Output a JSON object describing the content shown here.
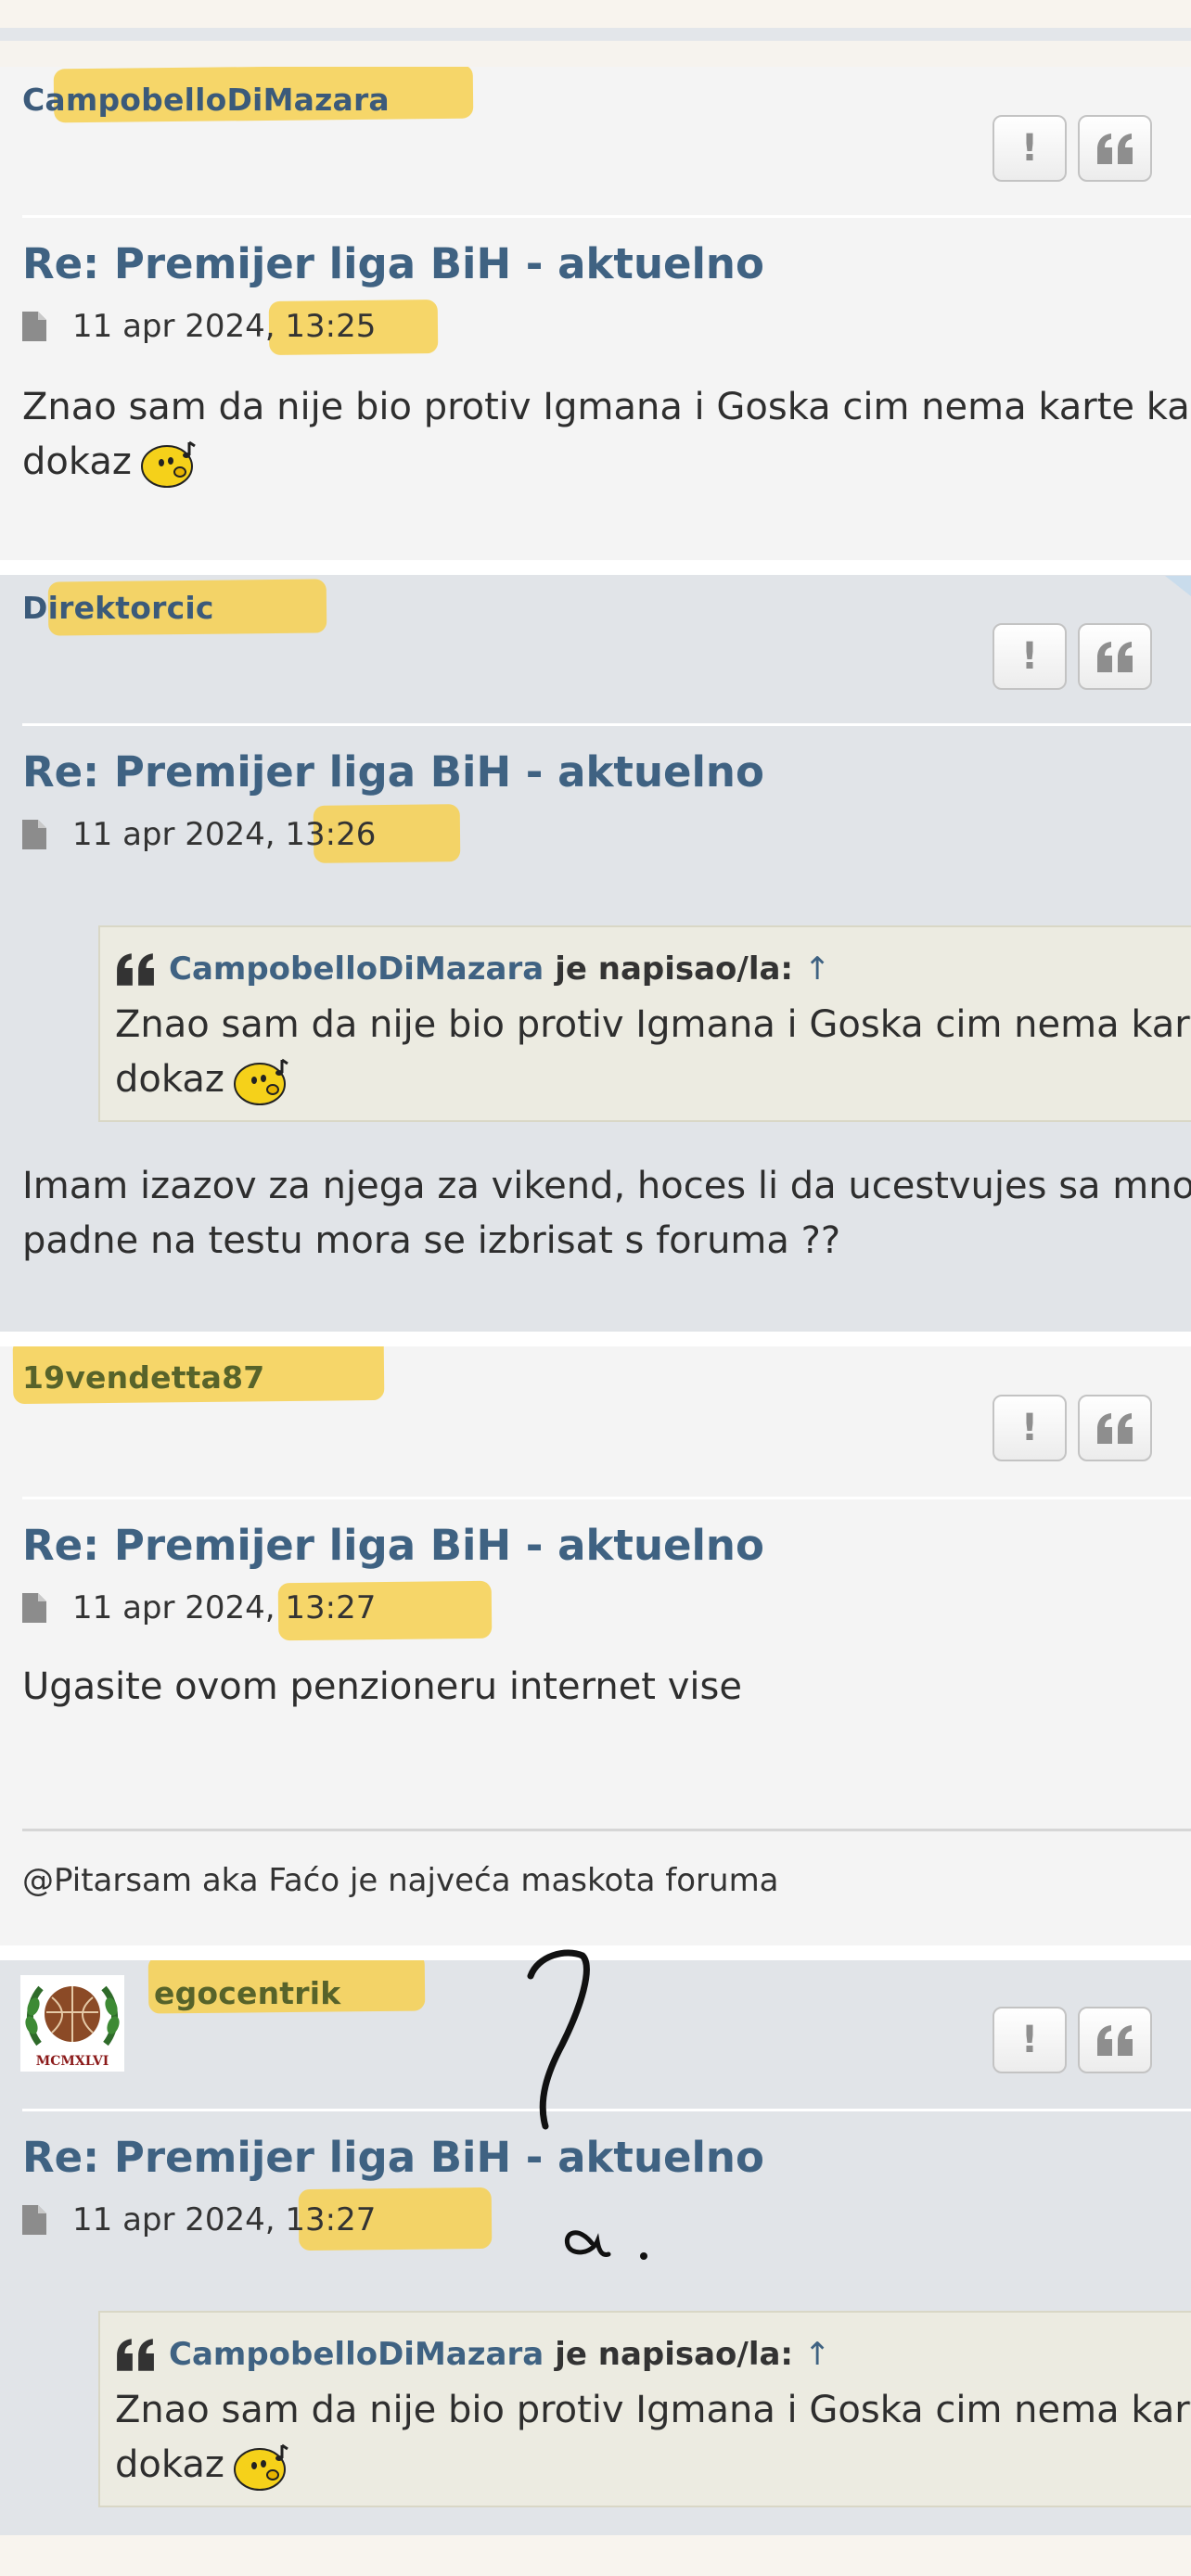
{
  "posts": [
    {
      "username": "CampobelloDiMazara",
      "title": "Re: Premijer liga BiH - aktuelno",
      "datetime": "11 apr 2024, 13:25",
      "content_lines": [
        "Znao sam da nije bio protiv Igmana i Goska cim nema karte kao",
        "dokaz"
      ],
      "buttons": {
        "report": "!",
        "quote_icon": "quote-icon"
      }
    },
    {
      "username": "Direktorcic",
      "title": "Re: Premijer liga BiH - aktuelno",
      "datetime": "11 apr 2024, 13:26",
      "quote": {
        "author": "CampobelloDiMazara",
        "wrote": "je napisao/la:",
        "arrow": "↑",
        "lines": [
          "Znao sam da nije bio protiv Igmana i Goska cim nema karte kao",
          "dokaz"
        ]
      },
      "content_lines": [
        "Imam izazov za njega za vikend, hoces li da ucestvujes sa mnom, a",
        "padne na testu mora se izbrisat s foruma ??"
      ],
      "buttons": {
        "report": "!",
        "quote_icon": "quote-icon"
      }
    },
    {
      "username": "19vendetta87",
      "title": "Re: Premijer liga BiH - aktuelno",
      "datetime": "11 apr 2024, 13:27",
      "content_lines": [
        "Ugasite ovom penzioneru internet vise"
      ],
      "signature": "@Pitarsam aka Faćo je najveća maskota foruma",
      "buttons": {
        "report": "!",
        "quote_icon": "quote-icon"
      }
    },
    {
      "username": "egocentrik",
      "avatar_text": "MCMXLVI",
      "title": "Re: Premijer liga BiH - aktuelno",
      "datetime": "11 apr 2024, 13:27",
      "quote": {
        "author": "CampobelloDiMazara",
        "wrote": "je napisao/la:",
        "arrow": "↑",
        "lines": [
          "Znao sam da nije bio protiv Igmana i Goska cim nema karte kao",
          "dokaz"
        ]
      },
      "buttons": {
        "report": "!",
        "quote_icon": "quote-icon"
      }
    }
  ],
  "annotations": {
    "handwritten": "? a."
  },
  "colors": {
    "link": "#3f6282",
    "highlight": "#f6d04a",
    "post_light": "#f4f4f4",
    "post_dark": "#e1e4e8",
    "quote_bg": "#ecebe1"
  },
  "icons": {
    "file": "file-icon",
    "quote": "quote-icon",
    "smiley": "whistling-smiley-icon"
  }
}
